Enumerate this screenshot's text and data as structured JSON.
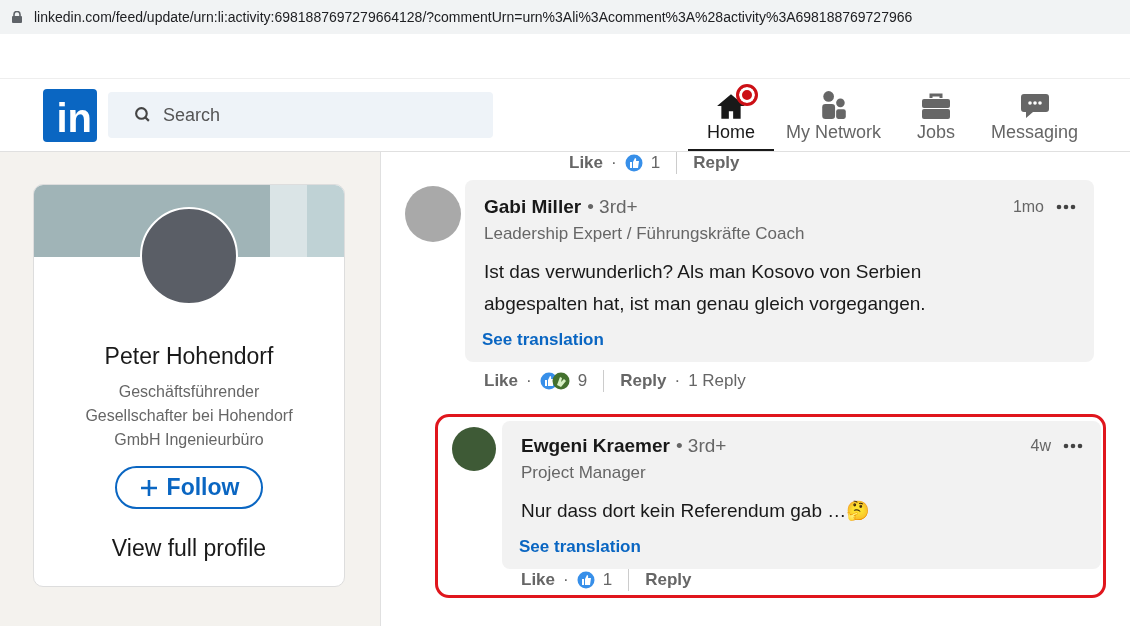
{
  "address_bar": {
    "url": "linkedin.com/feed/update/urn:li:activity:6981887697279664128/?commentUrn=urn%3Ali%3Acomment%3A%28activity%3A698188769727966"
  },
  "header": {
    "logo": "in",
    "search": {
      "placeholder": "Search"
    },
    "nav": [
      {
        "label": "Home",
        "kind": "home",
        "selected": true,
        "notification": true
      },
      {
        "label": "My Network",
        "kind": "network",
        "selected": false,
        "notification": false
      },
      {
        "label": "Jobs",
        "kind": "jobs",
        "selected": false,
        "notification": false
      },
      {
        "label": "Messaging",
        "kind": "messaging",
        "selected": false,
        "notification": false
      }
    ]
  },
  "profile_card": {
    "name": "Peter Hohendorf",
    "headline": "Geschäftsführender Gesellschafter bei Hohendorf GmbH Ingenieurbüro",
    "follow": "Follow",
    "view_profile": "View full profile"
  },
  "previous_actions": {
    "like": "Like",
    "separator": "·",
    "reactions": [
      {
        "kind": "like"
      }
    ],
    "count": "1",
    "reply": "Reply"
  },
  "comments": [
    {
      "author": "Gabi Miller",
      "degree": "• 3rd+",
      "headline": "Leadership Expert / Führungskräfte Coach",
      "time": "1mo",
      "text": "Ist das verwunderlich? Als man Kosovo von Serbien abgespalten hat, ist man genau gleich vorgegangen.",
      "translate": "See translation",
      "actions": {
        "like": "Like",
        "separator": "·",
        "reactions": [
          {
            "kind": "like"
          },
          {
            "kind": "celebrate"
          }
        ],
        "count": "9",
        "reply": "Reply",
        "separator_2": "·",
        "replies": "1 Reply"
      },
      "replies": [
        {
          "author": "Ewgeni Kraemer",
          "degree": "• 3rd+",
          "headline": "Project Manager",
          "time": "4w",
          "text": "Nur dass dort kein Referendum gab …🤔",
          "translate": "See translation",
          "highlighted": true,
          "actions": {
            "like": "Like",
            "separator": "·",
            "reactions": [
              {
                "kind": "like"
              }
            ],
            "count": "1",
            "reply": "Reply"
          }
        }
      ]
    }
  ]
}
